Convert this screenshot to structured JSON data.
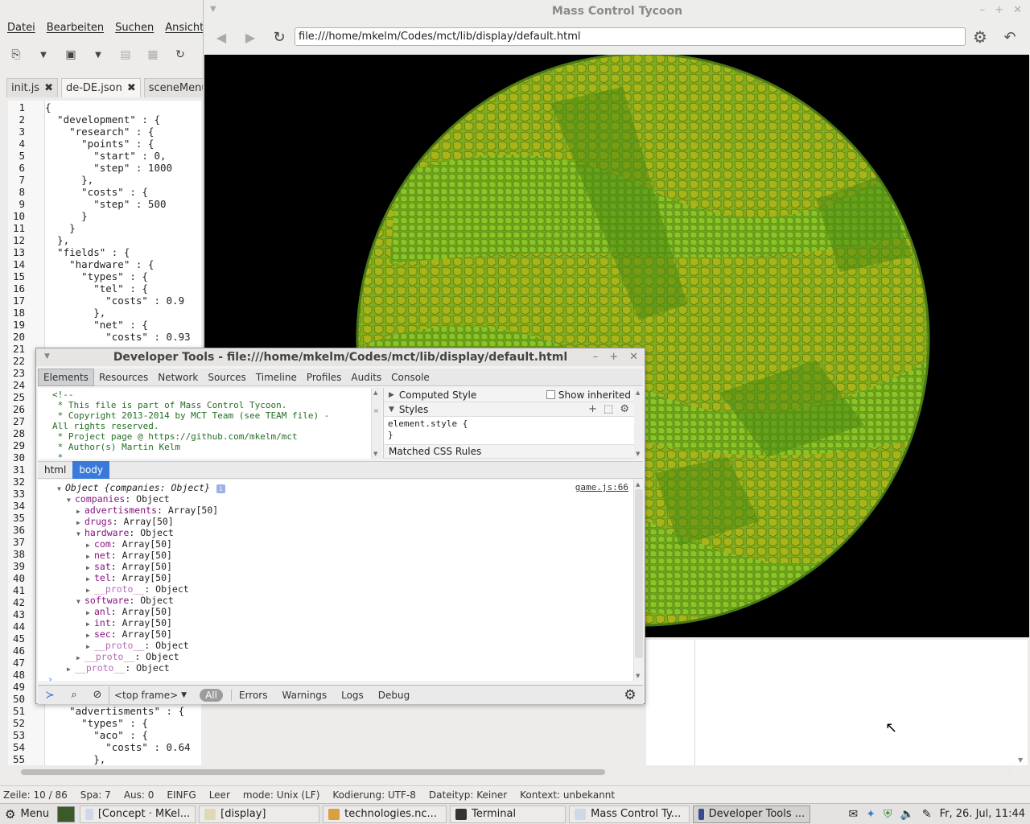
{
  "editor": {
    "menu": [
      "Datei",
      "Bearbeiten",
      "Suchen",
      "Ansicht"
    ],
    "tabs": [
      {
        "label": "init.js",
        "close": "✖"
      },
      {
        "label": "de-DE.json",
        "close": "✖"
      },
      {
        "label": "sceneMenu.js"
      }
    ],
    "line_numbers": [
      "1",
      "2",
      "3",
      "4",
      "5",
      "6",
      "7",
      "8",
      "9",
      "10",
      "11",
      "12",
      "13",
      "14",
      "15",
      "16",
      "17",
      "18",
      "19",
      "20",
      "21",
      "22",
      "23",
      "24",
      "25",
      "26",
      "27",
      "28",
      "29",
      "30",
      "31",
      "32",
      "33",
      "34",
      "35",
      "36",
      "37",
      "38",
      "39",
      "40",
      "41",
      "42",
      "43",
      "44",
      "45",
      "46",
      "47",
      "48",
      "49",
      "50",
      "51",
      "52",
      "53",
      "54",
      "55"
    ],
    "code_lines": [
      "{",
      "  \"development\" : {",
      "    \"research\" : {",
      "      \"points\" : {",
      "        \"start\" : 0,",
      "        \"step\" : 1000",
      "      },",
      "      \"costs\" : {",
      "        \"step\" : 500",
      "      }",
      "    }",
      "  },",
      "  \"fields\" : {",
      "    \"hardware\" : {",
      "      \"types\" : {",
      "        \"tel\" : {",
      "          \"costs\" : 0.9",
      "        },",
      "        \"net\" : {",
      "          \"costs\" : 0.93"
    ],
    "code_lines_bottom": [
      "    \"advertisments\" : {",
      "      \"types\" : {",
      "        \"aco\" : {",
      "          \"costs\" : 0.64",
      "        },"
    ],
    "status": [
      "Zeile: 10 / 86",
      "Spa: 7",
      "Aus: 0",
      "EINFG",
      "Leer",
      "mode: Unix (LF)",
      "Kodierung: UTF-8",
      "Dateityp: Keiner",
      "Kontext: unbekannt"
    ]
  },
  "browser": {
    "title": "Mass Control Tycoon",
    "url": "file:///home/mkelm/Codes/mct/lib/display/default.html",
    "win_controls": [
      "–",
      "+",
      "✕"
    ]
  },
  "devtools": {
    "title": "Developer Tools - file:///home/mkelm/Codes/mct/lib/display/default.html",
    "win_controls": [
      "–",
      "+",
      "✕"
    ],
    "tabs": [
      "Elements",
      "Resources",
      "Network",
      "Sources",
      "Timeline",
      "Profiles",
      "Audits",
      "Console"
    ],
    "active_tab": "Elements",
    "dom_lines": [
      "<!--",
      " * This file is part of Mass Control Tycoon.",
      " * Copyright 2013-2014 by MCT Team (see TEAM file) -",
      "All rights reserved.",
      " * Project page @ https://github.com/mkelm/mct",
      " * Author(s) Martin Kelm",
      " *"
    ],
    "side": {
      "computed": "Computed Style",
      "show_inherited": "Show inherited",
      "styles": "Styles",
      "element_style": "element.style {",
      "close_brace": "}",
      "matched": "Matched CSS Rules"
    },
    "breadcrumbs": [
      "html",
      "body"
    ],
    "console_source": "game.js:66",
    "console_lines": [
      {
        "indent": 1,
        "tri": "▼",
        "key": "Object {companies: Object}",
        "val": "",
        "italic": true,
        "info": "i"
      },
      {
        "indent": 2,
        "tri": "▼",
        "key": "companies",
        "val": ": Object"
      },
      {
        "indent": 3,
        "tri": "▶",
        "key": "advertisments",
        "val": ": Array[50]"
      },
      {
        "indent": 3,
        "tri": "▶",
        "key": "drugs",
        "val": ": Array[50]"
      },
      {
        "indent": 3,
        "tri": "▼",
        "key": "hardware",
        "val": ": Object"
      },
      {
        "indent": 4,
        "tri": "▶",
        "key": "com",
        "val": ": Array[50]"
      },
      {
        "indent": 4,
        "tri": "▶",
        "key": "net",
        "val": ": Array[50]"
      },
      {
        "indent": 4,
        "tri": "▶",
        "key": "sat",
        "val": ": Array[50]"
      },
      {
        "indent": 4,
        "tri": "▶",
        "key": "tel",
        "val": ": Array[50]"
      },
      {
        "indent": 4,
        "tri": "▶",
        "key": "__proto__",
        "val": ": Object",
        "dim": true
      },
      {
        "indent": 3,
        "tri": "▼",
        "key": "software",
        "val": ": Object"
      },
      {
        "indent": 4,
        "tri": "▶",
        "key": "anl",
        "val": ": Array[50]"
      },
      {
        "indent": 4,
        "tri": "▶",
        "key": "int",
        "val": ": Array[50]"
      },
      {
        "indent": 4,
        "tri": "▶",
        "key": "sec",
        "val": ": Array[50]"
      },
      {
        "indent": 4,
        "tri": "▶",
        "key": "__proto__",
        "val": ": Object",
        "dim": true
      },
      {
        "indent": 3,
        "tri": "▶",
        "key": "__proto__",
        "val": ": Object",
        "dim": true
      },
      {
        "indent": 2,
        "tri": "▶",
        "key": "__proto__",
        "val": ": Object",
        "dim": true
      }
    ],
    "console_bar": {
      "frame": "<top frame>",
      "filters": [
        "All",
        "Errors",
        "Warnings",
        "Logs",
        "Debug"
      ]
    }
  },
  "taskbar": {
    "menu": "Menu",
    "tasks": [
      "[Concept · MKel...",
      "[display]",
      "technologies.nc...",
      "Terminal",
      "Mass Control Ty...",
      "Developer Tools ..."
    ],
    "active_task": 5,
    "clock": "Fr, 26. Jul, 11:44"
  },
  "colors": {
    "accent": "#3879d9",
    "canvas_bg": "#000000",
    "petri_green": "#5a9a20",
    "petri_yellow": "#b8b020"
  }
}
